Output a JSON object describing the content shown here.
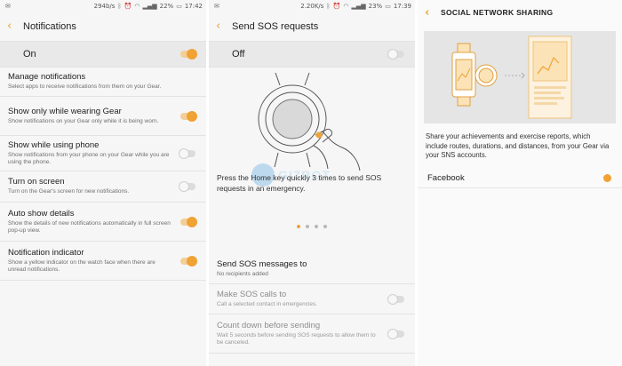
{
  "panel1": {
    "status": {
      "speed": "294b/s",
      "battery": "22%",
      "time": "17:42"
    },
    "title": "Notifications",
    "master": {
      "label": "On",
      "on": true
    },
    "rows": [
      {
        "title": "Manage notifications",
        "subtitle": "Select apps to receive notifications from them on your Gear.",
        "toggle": null
      },
      {
        "title": "Show only while wearing Gear",
        "subtitle": "Show notifications on your Gear only while it is being worn.",
        "toggle": true
      },
      {
        "title": "Show while using phone",
        "subtitle": "Show notifications from your phone on your Gear while you are using the phone.",
        "toggle": false
      },
      {
        "title": "Turn on screen",
        "subtitle": "Turn on the Gear's screen for new notifications.",
        "toggle": false
      },
      {
        "title": "Auto show details",
        "subtitle": "Show the details of new notifications automatically in full screen pop-up view.",
        "toggle": true
      },
      {
        "title": "Notification indicator",
        "subtitle": "Show a yellow indicator on the watch face when there are unread notifications.",
        "toggle": true
      }
    ]
  },
  "panel2": {
    "status": {
      "speed": "2.20K/s",
      "battery": "23%",
      "time": "17:39"
    },
    "title": "Send SOS requests",
    "master": {
      "label": "Off",
      "on": false
    },
    "instruction": "Press the Home key quickly 3 times to send SOS requests in an emergency.",
    "watermark": "GIZBOT",
    "pager": {
      "count": 4,
      "active": 0
    },
    "rows": [
      {
        "title": "Send SOS messages to",
        "subtitle": "No recipients added",
        "toggle": null,
        "disabled": false
      },
      {
        "title": "Make SOS calls to",
        "subtitle": "Call a selected contact in emergencies.",
        "toggle": false,
        "disabled": true
      },
      {
        "title": "Count down before sending",
        "subtitle": "Wait 5 seconds before sending SOS requests to allow them to be canceled.",
        "toggle": false,
        "disabled": true
      }
    ]
  },
  "panel3": {
    "title": "SOCIAL NETWORK SHARING",
    "description": "Share your achievements and exercise reports, which include routes, durations, and distances, from your Gear via your SNS accounts.",
    "item": {
      "label": "Facebook",
      "enabled": true
    }
  },
  "colors": {
    "accent": "#f0a235",
    "accent_light": "#f3cf98",
    "background": "#f6f6f6",
    "master_bar": "#e9e9e9"
  }
}
